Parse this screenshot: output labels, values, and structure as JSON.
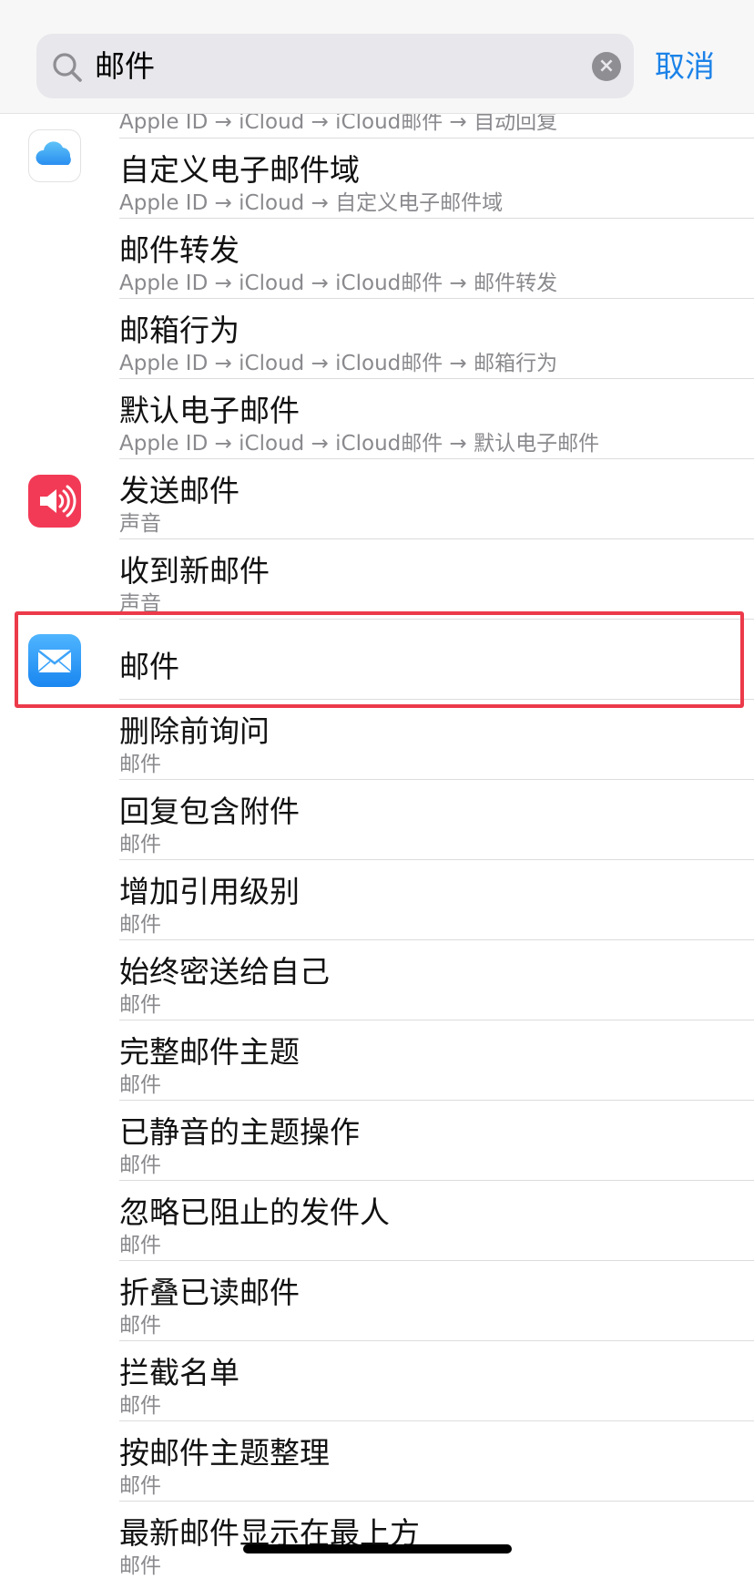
{
  "search": {
    "query": "邮件",
    "cancel_label": "取消"
  },
  "rows": [
    {
      "title": "",
      "subtitle": "Apple ID → iCloud → iCloud邮件 → 自动回复"
    },
    {
      "title": "自定义电子邮件域",
      "subtitle": "Apple ID → iCloud → 自定义电子邮件域",
      "icon": "icloud-icon"
    },
    {
      "title": "邮件转发",
      "subtitle": "Apple ID → iCloud → iCloud邮件 → 邮件转发"
    },
    {
      "title": "邮箱行为",
      "subtitle": "Apple ID → iCloud → iCloud邮件 → 邮箱行为"
    },
    {
      "title": "默认电子邮件",
      "subtitle": "Apple ID → iCloud → iCloud邮件 → 默认电子邮件"
    },
    {
      "title": "发送邮件",
      "subtitle": "声音",
      "icon": "speaker-icon"
    },
    {
      "title": "收到新邮件",
      "subtitle": "声音"
    },
    {
      "title": "邮件",
      "subtitle": "",
      "icon": "mail-envelope-icon"
    },
    {
      "title": "删除前询问",
      "subtitle": "邮件"
    },
    {
      "title": "回复包含附件",
      "subtitle": "邮件"
    },
    {
      "title": "增加引用级别",
      "subtitle": "邮件"
    },
    {
      "title": "始终密送给自己",
      "subtitle": "邮件"
    },
    {
      "title": "完整邮件主题",
      "subtitle": "邮件"
    },
    {
      "title": "已静音的主题操作",
      "subtitle": "邮件"
    },
    {
      "title": "忽略已阻止的发件人",
      "subtitle": "邮件"
    },
    {
      "title": "折叠已读邮件",
      "subtitle": "邮件"
    },
    {
      "title": "拦截名单",
      "subtitle": "邮件"
    },
    {
      "title": "按邮件主题整理",
      "subtitle": "邮件"
    },
    {
      "title": "最新邮件显示在最上方",
      "subtitle": "邮件"
    }
  ],
  "colors": {
    "accent": "#1b82e8",
    "highlight": "#ec3a4a",
    "sound_icon": "#f23a56"
  }
}
